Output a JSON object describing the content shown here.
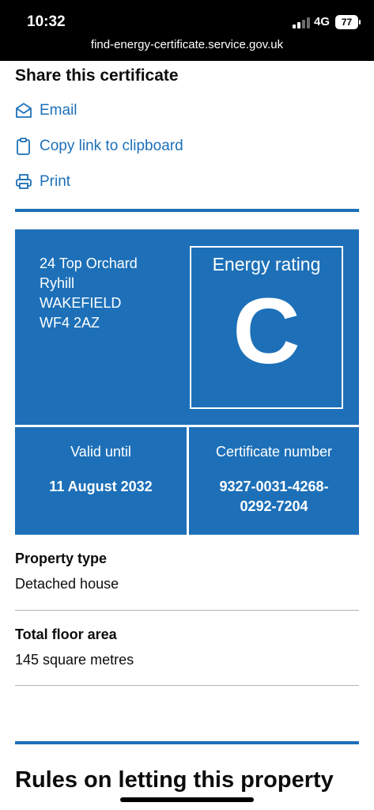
{
  "status": {
    "time": "10:32",
    "network": "4G",
    "battery": "77"
  },
  "browser": {
    "url": "find-energy-certificate.service.gov.uk"
  },
  "share": {
    "heading": "Share this certificate",
    "email_label": "Email",
    "copy_label": "Copy link to clipboard",
    "print_label": "Print"
  },
  "certificate": {
    "address": {
      "line1": "24 Top Orchard",
      "line2": "Ryhill",
      "line3": "WAKEFIELD",
      "postcode": "WF4 2AZ"
    },
    "rating_label": "Energy rating",
    "rating": "C",
    "valid_until_label": "Valid until",
    "valid_until": "11 August 2032",
    "certificate_number_label": "Certificate number",
    "certificate_number_line1": "9327-0031-4268-",
    "certificate_number_line2": "0292-7204"
  },
  "property": {
    "type_label": "Property type",
    "type_value": "Detached house",
    "area_label": "Total floor area",
    "area_value": "145 square metres"
  },
  "rules": {
    "heading": "Rules on letting this property"
  },
  "colors": {
    "brand_blue": "#1d70b8",
    "text": "#0b0c0c",
    "status_bar": "#000000",
    "divider_grey": "#b1b4b6"
  }
}
